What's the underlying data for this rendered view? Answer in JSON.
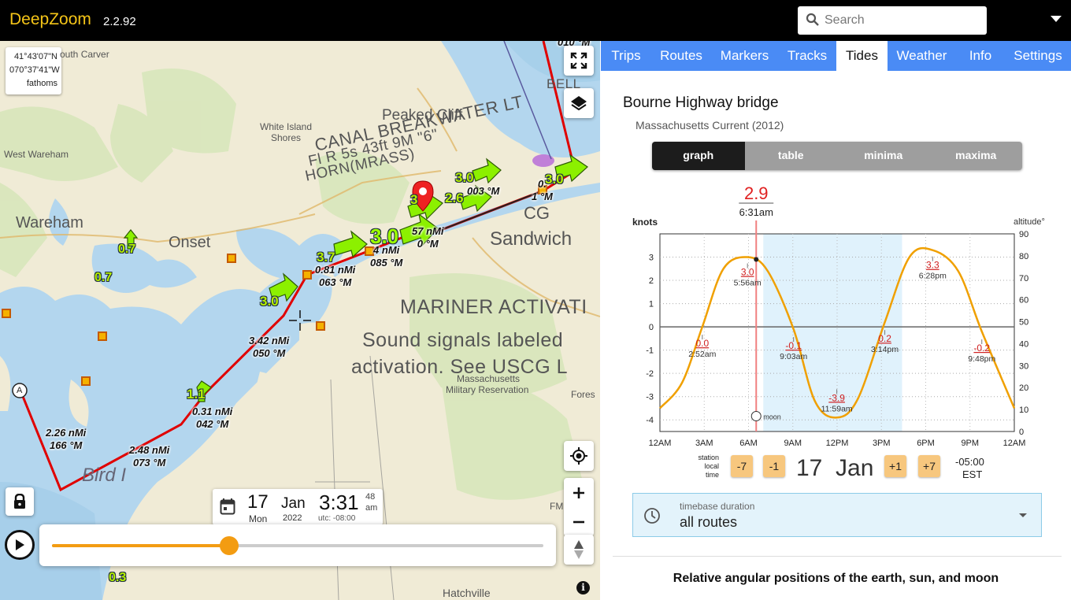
{
  "header": {
    "app_name": "DeepZoom",
    "version": "2.2.92",
    "search_placeholder": "Search"
  },
  "map": {
    "lat": "41°43'07\"N",
    "lon": "070°37'41\"W",
    "units": "fathoms",
    "places": {
      "south_carver": "outh Carver",
      "west_wareham": "West Wareham",
      "wareham": "Wareham",
      "onset": "Onset",
      "white_island": "White Island",
      "shores": "Shores",
      "peaked_cliff": "Peaked Cliff",
      "sandwich": "Sandwich",
      "cg": "CG",
      "mass_mil_1": "Massachusetts",
      "mass_mil_2": "Military Reservation",
      "forest": "Fores",
      "hatchville": "Hatchville",
      "bird_i": "Bird I",
      "fm": "FM",
      "route_marker": "A"
    },
    "chart_text": {
      "canal_1": "CANAL BREAKWATER LT",
      "canal_2": "Fl R 5s 43ft 9M \"6\"",
      "canal_3": "HORN(MRASS)",
      "mariner": "MARINER ACTIVATI",
      "sound": "Sound signals labeled",
      "activation": "activation. See USCG L",
      "bell": "BELL"
    },
    "route_labels": [
      {
        "dist": "2.26 nMi",
        "bearing": "166 °M"
      },
      {
        "dist": "2.48 nMi",
        "bearing": "073 °M"
      },
      {
        "dist": "0.31 nMi",
        "bearing": "042 °M"
      },
      {
        "dist": "3.42 nMi",
        "bearing": "050 °M"
      },
      {
        "dist": "0.81 nMi",
        "bearing": "063 °M"
      },
      {
        "dist": "4 nMi",
        "bearing": "085 °M"
      },
      {
        "dist": "57 nMi",
        "bearing": "0 °M"
      },
      {
        "dist": "003 °M",
        "bearing": ""
      },
      {
        "dist": "0.",
        "bearing": "1 °M"
      },
      {
        "dist": "010 °M",
        "bearing": ""
      }
    ],
    "tide_values": [
      "0.7",
      "0.7",
      "3.0",
      "3.7",
      "3.0",
      "3.0",
      "2.6",
      "3.0",
      "1.1",
      "0.3",
      "3"
    ]
  },
  "datetime": {
    "day": "17",
    "weekday": "Mon",
    "month": "Jan",
    "year": "2022",
    "time": "3:31",
    "seconds": "48",
    "ampm": "am",
    "utc": "utc: -08:00"
  },
  "timeline": {
    "position": 0.36
  },
  "tabs": [
    "Trips",
    "Routes",
    "Markers",
    "Tracks",
    "Tides",
    "Weather",
    "Info",
    "Settings"
  ],
  "active_tab": "Tides",
  "station": {
    "name": "Bourne Highway bridge",
    "subtitle": "Massachusetts Current (2012)"
  },
  "view_modes": [
    "graph",
    "table",
    "minima",
    "maxima"
  ],
  "active_mode": "graph",
  "current_reading": {
    "value": "2.9",
    "time": "6:31am"
  },
  "chart_data": {
    "type": "line",
    "ylabel": "knots",
    "y2label": "altitude°",
    "ylim": [
      -4.5,
      4
    ],
    "y2lim": [
      0,
      90
    ],
    "yticks": [
      "3",
      "2",
      "1",
      "0",
      "-1",
      "-2",
      "-3",
      "-4"
    ],
    "y2ticks": [
      "90",
      "80",
      "70",
      "60",
      "50",
      "40",
      "30",
      "20",
      "10",
      "0"
    ],
    "xticks": [
      "12AM",
      "3AM",
      "6AM",
      "9AM",
      "12PM",
      "3PM",
      "6PM",
      "9PM",
      "12AM"
    ],
    "x_hours": [
      0,
      3,
      6,
      9,
      12,
      15,
      18,
      21,
      24
    ],
    "series": [
      {
        "points": [
          {
            "x": 0,
            "y": -3.5
          },
          {
            "x": 1.5,
            "y": -2.4
          },
          {
            "x": 2.87,
            "y": 0.0
          },
          {
            "x": 4.3,
            "y": 2.5
          },
          {
            "x": 5.93,
            "y": 3.0
          },
          {
            "x": 7.3,
            "y": 2.4
          },
          {
            "x": 9.05,
            "y": -0.1
          },
          {
            "x": 10.5,
            "y": -3.2
          },
          {
            "x": 11.98,
            "y": -3.9
          },
          {
            "x": 13.4,
            "y": -3.1
          },
          {
            "x": 15.23,
            "y": 0.2
          },
          {
            "x": 16.9,
            "y": 3.0
          },
          {
            "x": 18.47,
            "y": 3.3
          },
          {
            "x": 20.2,
            "y": 2.4
          },
          {
            "x": 21.8,
            "y": -0.2
          },
          {
            "x": 24,
            "y": -3.5
          }
        ]
      }
    ],
    "extrema": [
      {
        "hour": 2.87,
        "value": "0.0",
        "label": "2:52am"
      },
      {
        "hour": 5.93,
        "value": "3.0",
        "label": "5:56am"
      },
      {
        "hour": 9.05,
        "value": "-0.1",
        "label": "9:03am"
      },
      {
        "hour": 11.98,
        "value": "-3.9",
        "label": "11:59am"
      },
      {
        "hour": 15.23,
        "value": "0.2",
        "label": "3:14pm"
      },
      {
        "hour": 18.47,
        "value": "3.3",
        "label": "6:28pm"
      },
      {
        "hour": 21.8,
        "value": "-0.2",
        "label": "9:48pm"
      }
    ],
    "current_hour": 6.52,
    "current_value": 2.9,
    "daylight": [
      7.0,
      16.4
    ],
    "moon": {
      "label": "moon",
      "altitude": 7
    }
  },
  "station_time": {
    "label_1": "station",
    "label_2": "local",
    "label_3": "time",
    "step_buttons": [
      "-7",
      "-1",
      "+1",
      "+7"
    ],
    "date": "17  Jan",
    "offset": "-05:00",
    "zone": "EST"
  },
  "timebase": {
    "label": "timebase duration",
    "value": "all routes"
  },
  "relative_title": "Relative angular positions of the earth, sun, and moon",
  "colors": {
    "accent": "#f39c12",
    "tab_bar": "#4a8bf5",
    "route": "#e00000",
    "tide_arrow": "#8cf000",
    "current_line": "#e82020"
  }
}
